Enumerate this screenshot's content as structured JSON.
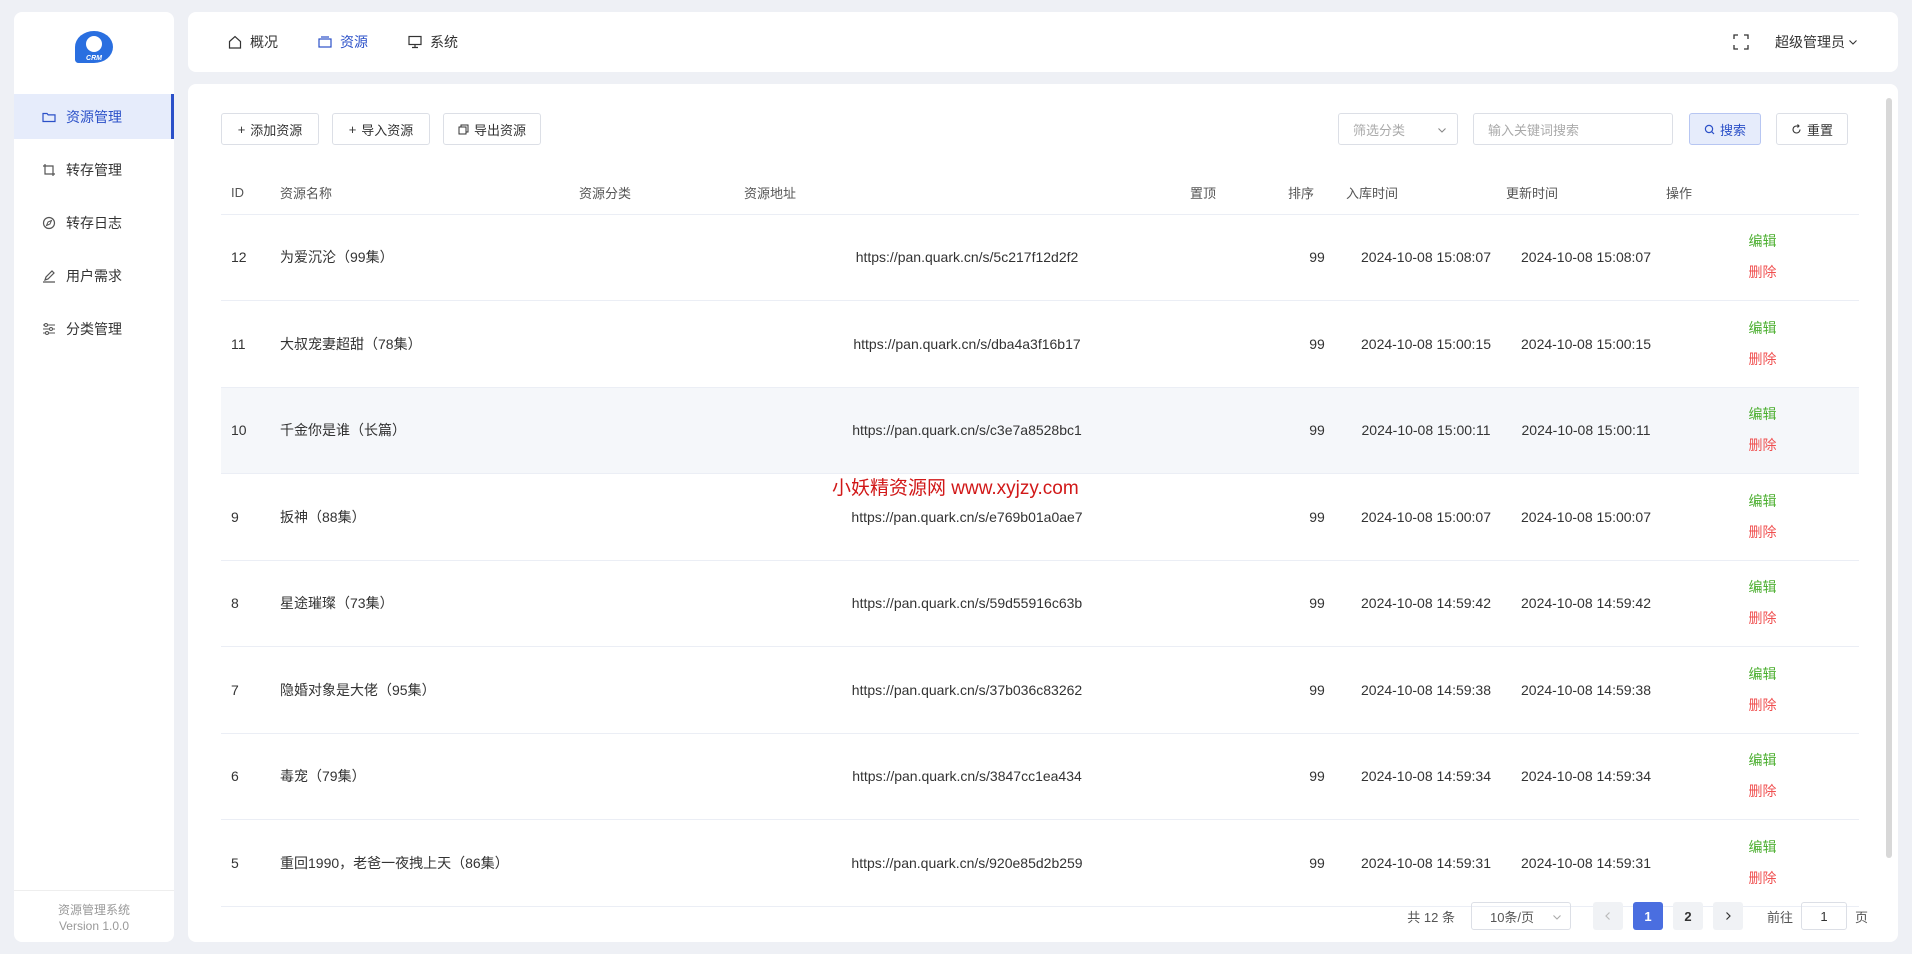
{
  "sidebar": {
    "logo_text": "CRM",
    "items": [
      {
        "label": "资源管理",
        "icon": "folder-icon",
        "active": true
      },
      {
        "label": "转存管理",
        "icon": "crop-icon",
        "active": false
      },
      {
        "label": "转存日志",
        "icon": "compass-icon",
        "active": false
      },
      {
        "label": "用户需求",
        "icon": "pen-icon",
        "active": false
      },
      {
        "label": "分类管理",
        "icon": "sliders-icon",
        "active": false
      }
    ],
    "footer_name": "资源管理系统",
    "footer_version": "Version 1.0.0"
  },
  "header": {
    "tabs": [
      {
        "label": "概况",
        "icon": "home-icon",
        "active": false
      },
      {
        "label": "资源",
        "icon": "box-icon",
        "active": true
      },
      {
        "label": "系统",
        "icon": "monitor-icon",
        "active": false
      }
    ],
    "user": "超级管理员"
  },
  "toolbar": {
    "add_label": "添加资源",
    "import_label": "导入资源",
    "export_label": "导出资源",
    "category_placeholder": "筛选分类",
    "search_placeholder": "输入关键词搜索",
    "search_label": "搜索",
    "reset_label": "重置"
  },
  "table": {
    "columns": [
      "ID",
      "资源名称",
      "资源分类",
      "资源地址",
      "置顶",
      "排序",
      "入库时间",
      "更新时间",
      "操作"
    ],
    "rows": [
      {
        "id": "12",
        "name": "为爱沉沦（99集）",
        "category": "",
        "url": "https://pan.quark.cn/s/5c217f12d2f2",
        "pin": "",
        "sort": "99",
        "created": "2024-10-08 15:08:07",
        "updated": "2024-10-08 15:08:07"
      },
      {
        "id": "11",
        "name": "大叔宠妻超甜（78集）",
        "category": "",
        "url": "https://pan.quark.cn/s/dba4a3f16b17",
        "pin": "",
        "sort": "99",
        "created": "2024-10-08 15:00:15",
        "updated": "2024-10-08 15:00:15"
      },
      {
        "id": "10",
        "name": "千金你是谁（长篇）",
        "category": "",
        "url": "https://pan.quark.cn/s/c3e7a8528bc1",
        "pin": "",
        "sort": "99",
        "created": "2024-10-08 15:00:11",
        "updated": "2024-10-08 15:00:11"
      },
      {
        "id": "9",
        "name": "扳神（88集）",
        "category": "",
        "url": "https://pan.quark.cn/s/e769b01a0ae7",
        "pin": "",
        "sort": "99",
        "created": "2024-10-08 15:00:07",
        "updated": "2024-10-08 15:00:07"
      },
      {
        "id": "8",
        "name": "星途璀璨（73集）",
        "category": "",
        "url": "https://pan.quark.cn/s/59d55916c63b",
        "pin": "",
        "sort": "99",
        "created": "2024-10-08 14:59:42",
        "updated": "2024-10-08 14:59:42"
      },
      {
        "id": "7",
        "name": "隐婚对象是大佬（95集）",
        "category": "",
        "url": "https://pan.quark.cn/s/37b036c83262",
        "pin": "",
        "sort": "99",
        "created": "2024-10-08 14:59:38",
        "updated": "2024-10-08 14:59:38"
      },
      {
        "id": "6",
        "name": "毒宠（79集）",
        "category": "",
        "url": "https://pan.quark.cn/s/3847cc1ea434",
        "pin": "",
        "sort": "99",
        "created": "2024-10-08 14:59:34",
        "updated": "2024-10-08 14:59:34"
      },
      {
        "id": "5",
        "name": "重回1990，老爸一夜拽上天（86集）",
        "category": "",
        "url": "https://pan.quark.cn/s/920e85d2b259",
        "pin": "",
        "sort": "99",
        "created": "2024-10-08 14:59:31",
        "updated": "2024-10-08 14:59:31"
      }
    ],
    "edit_label": "编辑",
    "delete_label": "删除",
    "highlighted_row": 2
  },
  "watermark": "小妖精资源网 www.xyjzy.com",
  "pagination": {
    "total": "共 12 条",
    "page_size": "10条/页",
    "pages": [
      "1",
      "2"
    ],
    "current": "1",
    "goto_prefix": "前往",
    "goto_value": "1",
    "goto_suffix": "页"
  },
  "colors": {
    "accent": "#2b50c8",
    "edit": "#4caf30",
    "delete": "#f05050",
    "watermark": "#d11818"
  }
}
